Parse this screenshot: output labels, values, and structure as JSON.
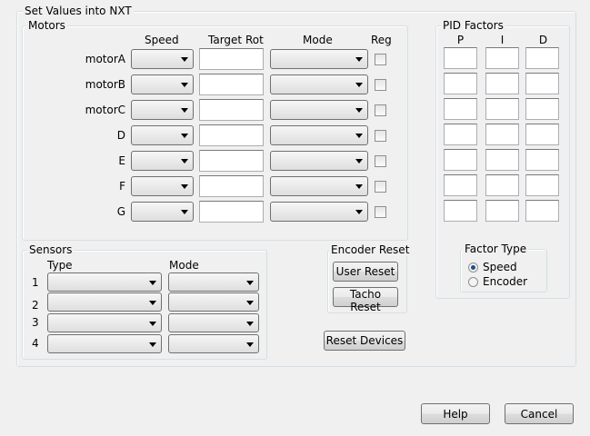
{
  "main_group": {
    "title": "Set Values into NXT"
  },
  "motors": {
    "title": "Motors",
    "headers": {
      "speed": "Speed",
      "target_rot": "Target Rot",
      "mode": "Mode",
      "reg": "Reg"
    },
    "rows": [
      {
        "label": "motorA"
      },
      {
        "label": "motorB"
      },
      {
        "label": "motorC"
      },
      {
        "label": "D"
      },
      {
        "label": "E"
      },
      {
        "label": "F"
      },
      {
        "label": "G"
      }
    ]
  },
  "pid": {
    "title": "PID Factors",
    "headers": {
      "p": "P",
      "i": "I",
      "d": "D"
    },
    "factor_type": {
      "title": "Factor Type",
      "options": [
        {
          "label": "Speed",
          "selected": true
        },
        {
          "label": "Encoder",
          "selected": false
        }
      ]
    }
  },
  "sensors": {
    "title": "Sensors",
    "headers": {
      "type": "Type",
      "mode": "Mode"
    },
    "rows": [
      {
        "label": "1"
      },
      {
        "label": "2"
      },
      {
        "label": "3"
      },
      {
        "label": "4"
      }
    ]
  },
  "encoder_reset": {
    "title": "Encoder Reset",
    "user_reset": "User Reset",
    "tacho_reset": "Tacho Reset"
  },
  "reset_devices": "Reset Devices",
  "footer": {
    "help": "Help",
    "cancel": "Cancel"
  }
}
